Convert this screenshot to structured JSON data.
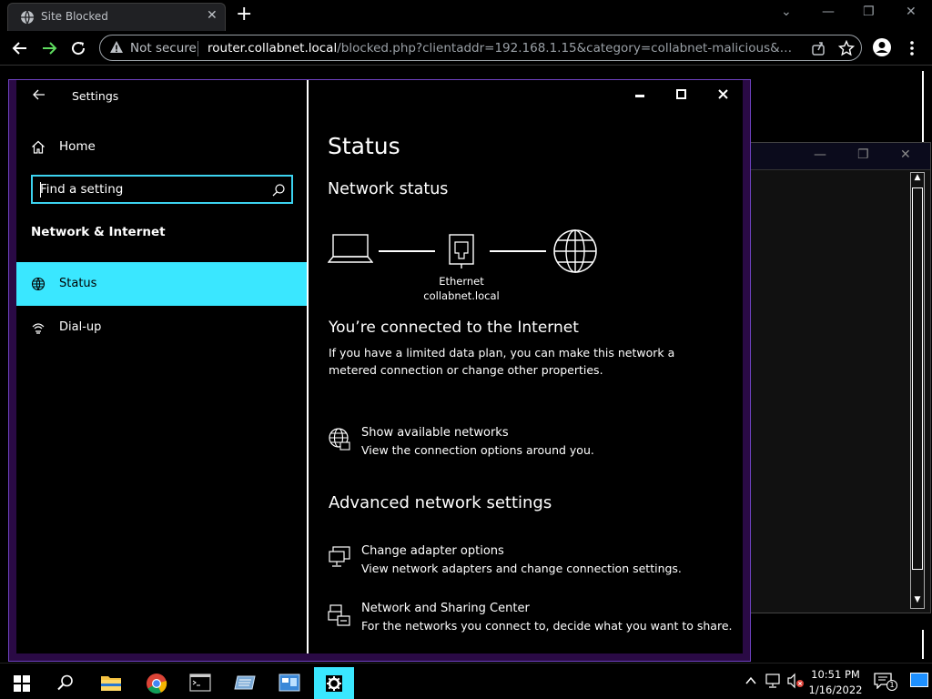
{
  "browser": {
    "tab_title": "Site Blocked",
    "tab_close": "✕",
    "new_tab": "+",
    "minimize": "⌄",
    "win_minimize": "—",
    "win_restore": "❐",
    "win_close": "✕",
    "security_label": "Not secure",
    "url_host": "router.collabnet.local",
    "url_path": "/blocked.php?clientaddr=192.168.1.15&category=collabnet-malicious&url=github...."
  },
  "settings": {
    "window_title": "Settings",
    "home_label": "Home",
    "search_placeholder": "Find a setting",
    "section_label": "Network & Internet",
    "nav_items": [
      {
        "label": "Status",
        "icon": "globe-icon",
        "active": true
      },
      {
        "label": "Dial-up",
        "icon": "dialup-icon",
        "active": false
      }
    ],
    "page_title": "Status",
    "network_status_heading": "Network status",
    "adapter_name": "Ethernet",
    "adapter_domain": "collabnet.local",
    "connected_heading": "You’re connected to the Internet",
    "connected_text": "If you have a limited data plan, you can make this network a metered connection or change other properties.",
    "show_networks_title": "Show available networks",
    "show_networks_desc": "View the connection options around you.",
    "advanced_heading": "Advanced network settings",
    "adapter_options_title": "Change adapter options",
    "adapter_options_desc": "View network adapters and change connection settings.",
    "sharing_center_title": "Network and Sharing Center",
    "sharing_center_desc": "For the networks you connect to, decide what you want to share."
  },
  "taskbar": {
    "time": "10:51 PM",
    "date": "1/16/2022",
    "notification_count": "1",
    "accent": "#3ae7ff"
  }
}
